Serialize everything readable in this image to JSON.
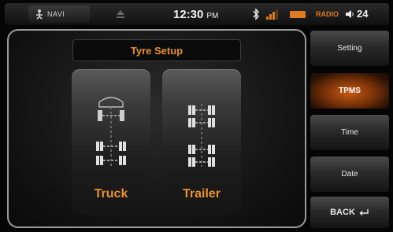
{
  "status_bar": {
    "navi_label": "NAVI",
    "time": "12:30",
    "ampm": "PM",
    "radio_label": "RADIO",
    "volume": "24"
  },
  "main": {
    "title": "Tyre Setup",
    "options": [
      {
        "label": "Truck"
      },
      {
        "label": "Trailer"
      }
    ]
  },
  "menu": {
    "items": [
      {
        "label": "Setting"
      },
      {
        "label": "TPMS"
      },
      {
        "label": "Time"
      },
      {
        "label": "Date"
      },
      {
        "label": "BACK"
      }
    ],
    "active_index": 1
  },
  "colors": {
    "accent": "#e8902e",
    "active_bg": "#c85a14"
  }
}
